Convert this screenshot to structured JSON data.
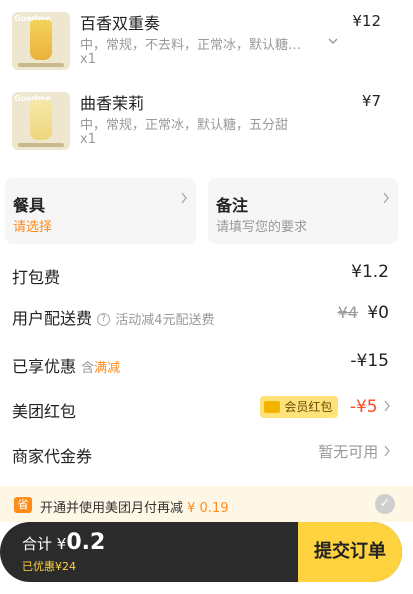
{
  "items": [
    {
      "name": "百香双重奏",
      "spec": "中，常规，不去料，正常冰，默认糖…",
      "qty": "x1",
      "price": "¥12",
      "thumb_brand": "Goodme"
    },
    {
      "name": "曲香茉莉",
      "spec": "中，常规，正常冰，默认糖，五分甜",
      "qty": "x1",
      "price": "¥7",
      "thumb_brand": "Goodme"
    }
  ],
  "cards": {
    "utensils": {
      "title": "餐具",
      "sub": "请选择"
    },
    "notes": {
      "title": "备注",
      "sub": "请填写您的要求"
    }
  },
  "fees": {
    "packing": {
      "label": "打包费",
      "value": "¥1.2"
    },
    "delivery": {
      "label": "用户配送费",
      "hint": "活动减4元配送费",
      "original": "¥4",
      "value": "¥0"
    },
    "discount": {
      "label": "已享优惠",
      "tag_prefix": "含",
      "tag": "满减",
      "value": "-¥15"
    },
    "redpacket": {
      "label": "美团红包",
      "badge": "会员红包",
      "value": "-¥5"
    },
    "voucher": {
      "label": "商家代金券",
      "value": "暂无可用"
    }
  },
  "banner": {
    "icon": "省",
    "text": "开通并使用美团月付再减",
    "amount": "¥ 0.19"
  },
  "footer": {
    "total_label": "合计",
    "total_currency": "¥",
    "total_value": "0.2",
    "discount_text": "已优惠¥24",
    "submit_label": "提交订单"
  },
  "colors": {
    "accent": "#ffd23f",
    "discount_red": "#ff4a26",
    "footer_bg": "#2b2b2b",
    "tag_orange": "#ff8b1a"
  }
}
